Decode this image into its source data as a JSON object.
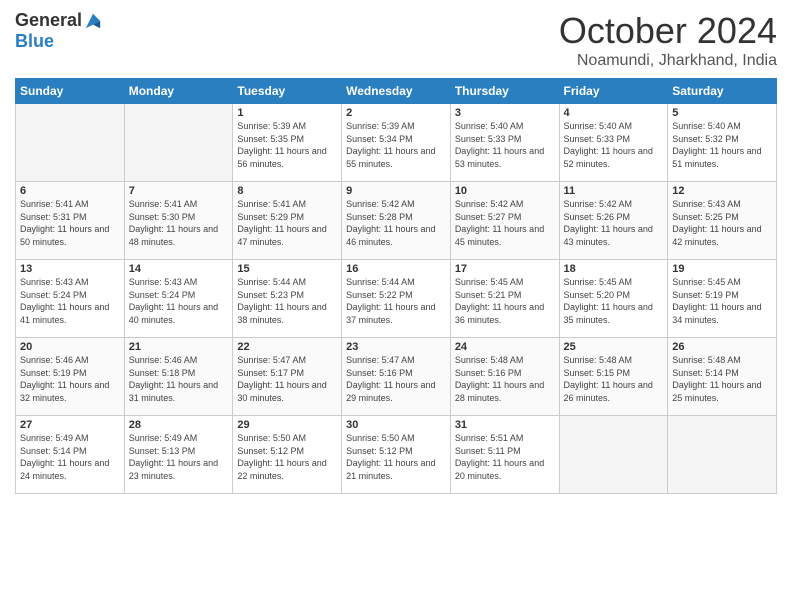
{
  "header": {
    "logo_general": "General",
    "logo_blue": "Blue",
    "month_title": "October 2024",
    "location": "Noamundi, Jharkhand, India"
  },
  "weekdays": [
    "Sunday",
    "Monday",
    "Tuesday",
    "Wednesday",
    "Thursday",
    "Friday",
    "Saturday"
  ],
  "weeks": [
    [
      {
        "day": null,
        "sunrise": null,
        "sunset": null,
        "daylight": null
      },
      {
        "day": null,
        "sunrise": null,
        "sunset": null,
        "daylight": null
      },
      {
        "day": 1,
        "sunrise": "Sunrise: 5:39 AM",
        "sunset": "Sunset: 5:35 PM",
        "daylight": "Daylight: 11 hours and 56 minutes."
      },
      {
        "day": 2,
        "sunrise": "Sunrise: 5:39 AM",
        "sunset": "Sunset: 5:34 PM",
        "daylight": "Daylight: 11 hours and 55 minutes."
      },
      {
        "day": 3,
        "sunrise": "Sunrise: 5:40 AM",
        "sunset": "Sunset: 5:33 PM",
        "daylight": "Daylight: 11 hours and 53 minutes."
      },
      {
        "day": 4,
        "sunrise": "Sunrise: 5:40 AM",
        "sunset": "Sunset: 5:33 PM",
        "daylight": "Daylight: 11 hours and 52 minutes."
      },
      {
        "day": 5,
        "sunrise": "Sunrise: 5:40 AM",
        "sunset": "Sunset: 5:32 PM",
        "daylight": "Daylight: 11 hours and 51 minutes."
      }
    ],
    [
      {
        "day": 6,
        "sunrise": "Sunrise: 5:41 AM",
        "sunset": "Sunset: 5:31 PM",
        "daylight": "Daylight: 11 hours and 50 minutes."
      },
      {
        "day": 7,
        "sunrise": "Sunrise: 5:41 AM",
        "sunset": "Sunset: 5:30 PM",
        "daylight": "Daylight: 11 hours and 48 minutes."
      },
      {
        "day": 8,
        "sunrise": "Sunrise: 5:41 AM",
        "sunset": "Sunset: 5:29 PM",
        "daylight": "Daylight: 11 hours and 47 minutes."
      },
      {
        "day": 9,
        "sunrise": "Sunrise: 5:42 AM",
        "sunset": "Sunset: 5:28 PM",
        "daylight": "Daylight: 11 hours and 46 minutes."
      },
      {
        "day": 10,
        "sunrise": "Sunrise: 5:42 AM",
        "sunset": "Sunset: 5:27 PM",
        "daylight": "Daylight: 11 hours and 45 minutes."
      },
      {
        "day": 11,
        "sunrise": "Sunrise: 5:42 AM",
        "sunset": "Sunset: 5:26 PM",
        "daylight": "Daylight: 11 hours and 43 minutes."
      },
      {
        "day": 12,
        "sunrise": "Sunrise: 5:43 AM",
        "sunset": "Sunset: 5:25 PM",
        "daylight": "Daylight: 11 hours and 42 minutes."
      }
    ],
    [
      {
        "day": 13,
        "sunrise": "Sunrise: 5:43 AM",
        "sunset": "Sunset: 5:24 PM",
        "daylight": "Daylight: 11 hours and 41 minutes."
      },
      {
        "day": 14,
        "sunrise": "Sunrise: 5:43 AM",
        "sunset": "Sunset: 5:24 PM",
        "daylight": "Daylight: 11 hours and 40 minutes."
      },
      {
        "day": 15,
        "sunrise": "Sunrise: 5:44 AM",
        "sunset": "Sunset: 5:23 PM",
        "daylight": "Daylight: 11 hours and 38 minutes."
      },
      {
        "day": 16,
        "sunrise": "Sunrise: 5:44 AM",
        "sunset": "Sunset: 5:22 PM",
        "daylight": "Daylight: 11 hours and 37 minutes."
      },
      {
        "day": 17,
        "sunrise": "Sunrise: 5:45 AM",
        "sunset": "Sunset: 5:21 PM",
        "daylight": "Daylight: 11 hours and 36 minutes."
      },
      {
        "day": 18,
        "sunrise": "Sunrise: 5:45 AM",
        "sunset": "Sunset: 5:20 PM",
        "daylight": "Daylight: 11 hours and 35 minutes."
      },
      {
        "day": 19,
        "sunrise": "Sunrise: 5:45 AM",
        "sunset": "Sunset: 5:19 PM",
        "daylight": "Daylight: 11 hours and 34 minutes."
      }
    ],
    [
      {
        "day": 20,
        "sunrise": "Sunrise: 5:46 AM",
        "sunset": "Sunset: 5:19 PM",
        "daylight": "Daylight: 11 hours and 32 minutes."
      },
      {
        "day": 21,
        "sunrise": "Sunrise: 5:46 AM",
        "sunset": "Sunset: 5:18 PM",
        "daylight": "Daylight: 11 hours and 31 minutes."
      },
      {
        "day": 22,
        "sunrise": "Sunrise: 5:47 AM",
        "sunset": "Sunset: 5:17 PM",
        "daylight": "Daylight: 11 hours and 30 minutes."
      },
      {
        "day": 23,
        "sunrise": "Sunrise: 5:47 AM",
        "sunset": "Sunset: 5:16 PM",
        "daylight": "Daylight: 11 hours and 29 minutes."
      },
      {
        "day": 24,
        "sunrise": "Sunrise: 5:48 AM",
        "sunset": "Sunset: 5:16 PM",
        "daylight": "Daylight: 11 hours and 28 minutes."
      },
      {
        "day": 25,
        "sunrise": "Sunrise: 5:48 AM",
        "sunset": "Sunset: 5:15 PM",
        "daylight": "Daylight: 11 hours and 26 minutes."
      },
      {
        "day": 26,
        "sunrise": "Sunrise: 5:48 AM",
        "sunset": "Sunset: 5:14 PM",
        "daylight": "Daylight: 11 hours and 25 minutes."
      }
    ],
    [
      {
        "day": 27,
        "sunrise": "Sunrise: 5:49 AM",
        "sunset": "Sunset: 5:14 PM",
        "daylight": "Daylight: 11 hours and 24 minutes."
      },
      {
        "day": 28,
        "sunrise": "Sunrise: 5:49 AM",
        "sunset": "Sunset: 5:13 PM",
        "daylight": "Daylight: 11 hours and 23 minutes."
      },
      {
        "day": 29,
        "sunrise": "Sunrise: 5:50 AM",
        "sunset": "Sunset: 5:12 PM",
        "daylight": "Daylight: 11 hours and 22 minutes."
      },
      {
        "day": 30,
        "sunrise": "Sunrise: 5:50 AM",
        "sunset": "Sunset: 5:12 PM",
        "daylight": "Daylight: 11 hours and 21 minutes."
      },
      {
        "day": 31,
        "sunrise": "Sunrise: 5:51 AM",
        "sunset": "Sunset: 5:11 PM",
        "daylight": "Daylight: 11 hours and 20 minutes."
      },
      {
        "day": null,
        "sunrise": null,
        "sunset": null,
        "daylight": null
      },
      {
        "day": null,
        "sunrise": null,
        "sunset": null,
        "daylight": null
      }
    ]
  ]
}
